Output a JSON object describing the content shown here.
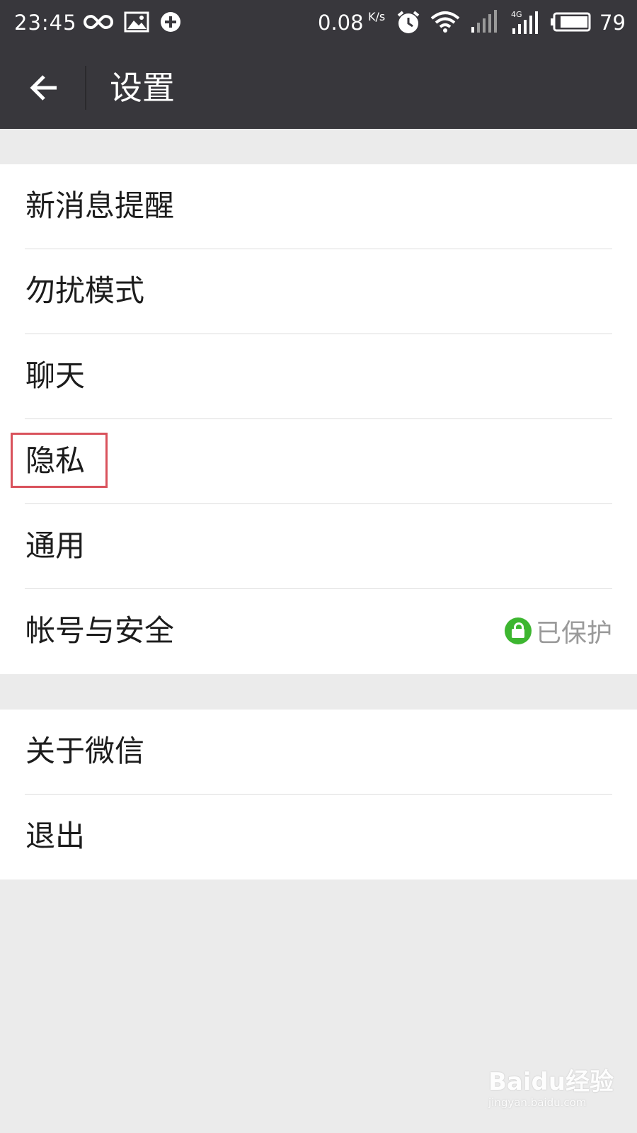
{
  "status_bar": {
    "time": "23:45",
    "speed": "0.08",
    "speed_unit": "K/s",
    "battery": "79"
  },
  "header": {
    "title": "设置"
  },
  "groups": [
    {
      "items": [
        {
          "label": "新消息提醒"
        },
        {
          "label": "勿扰模式"
        },
        {
          "label": "聊天"
        },
        {
          "label": "隐私"
        },
        {
          "label": "通用"
        },
        {
          "label": "帐号与安全",
          "status": "已保护"
        }
      ]
    },
    {
      "items": [
        {
          "label": "关于微信"
        },
        {
          "label": "退出"
        }
      ]
    }
  ],
  "watermark": {
    "brand": "Baidu经验",
    "site": "jingyan.baidu.com"
  },
  "colors": {
    "title_bar": "#38373c",
    "background": "#ebebeb",
    "protected_green": "#3db630",
    "highlight_red": "#d9525c"
  },
  "icons": {
    "status_bar": [
      "infinity-icon",
      "image-icon",
      "sync-plus-icon",
      "alarm-icon",
      "wifi-icon",
      "signal-icon",
      "4g-signal-icon",
      "battery-icon"
    ],
    "back": "arrow-left-icon",
    "lock": "lock-icon"
  },
  "highlighted_item": "隐私"
}
